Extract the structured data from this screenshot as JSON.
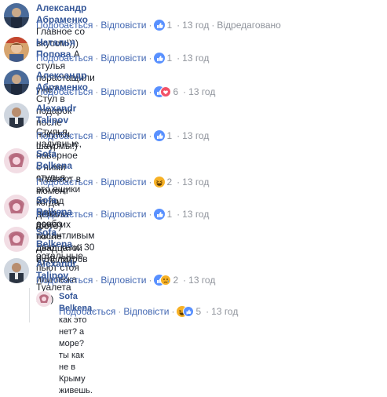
{
  "comments": [
    {
      "author": "Александр Абраменко",
      "text": "Главное со вкусом!)))",
      "like": "Подобається",
      "reply": "Відповісти",
      "count": "1",
      "time": "13 год",
      "extra": "Відредаговано"
    },
    {
      "author": "Наталья Попова",
      "text": "А стулья порастащили уже?",
      "like": "Подобається",
      "reply": "Відповісти",
      "count": "1",
      "time": "13 год"
    },
    {
      "author": "Александр Абраменко",
      "text": "Стул в подарок после покупки шаурмы!)",
      "like": "Подобається",
      "reply": "Відповісти",
      "count": "6",
      "time": "13 год"
    },
    {
      "author": "Alexandr Talipov",
      "text": "Стулья надувные, наверное с ними плавают в момент",
      "text2": "когда делали фото)",
      "like": "Подобається",
      "reply": "Відповісти",
      "count": "1",
      "time": "13 год"
    },
    {
      "author": "Sofa Belkena",
      "text": "стулья - это ящики из под пива. дают их после двадцатой",
      "text2": "бутылки",
      "like": "Подобається",
      "reply": "Відповісти",
      "count": "2",
      "time": "13 год"
    },
    {
      "author": "Sofa Belkena",
      "text": "особо талантливым дают кеги. 30 и 50 литров",
      "like": "Подобається",
      "reply": "Відповісти",
      "count": "1",
      "time": "13 год"
    },
    {
      "author": "Sofa Belkena",
      "text": "остальные пьют стоя или лежа"
    },
    {
      "author": "Alexandr Talipov",
      "text": "Туалета нет)",
      "like": "Подобається",
      "reply": "Відповісти",
      "count": "2",
      "time": "13 год"
    },
    {
      "author": "Sofa Belkena",
      "text": "как это нет? а море? ты как не в Крыму живешь.",
      "like": "Подобається",
      "reply": "Відповісти",
      "count": "5",
      "time": "13 год"
    }
  ],
  "colors": {
    "author": "#365899",
    "link": "#4267b2",
    "muted": "#90949c",
    "like_blue": "#5890ff",
    "haha_yellow": "#f7b125",
    "love_red": "#f25268"
  }
}
